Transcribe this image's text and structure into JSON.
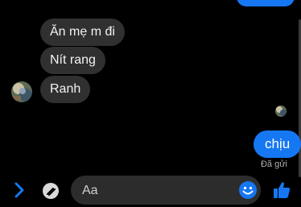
{
  "thread": {
    "incoming": [
      {
        "text": "Ăn mẹ m đi"
      },
      {
        "text": "Nít rang"
      },
      {
        "text": "Ranh"
      }
    ],
    "outgoing": [
      {
        "text": "chịu"
      }
    ],
    "sent_status": "Đã gửi"
  },
  "composer": {
    "placeholder": "Aa"
  },
  "icons": {
    "expand": "chevron-right-icon",
    "attach": "attachment-icon",
    "emoji": "emoji-icon",
    "like": "thumbs-up-icon"
  },
  "colors": {
    "accent": "#1677f2",
    "incoming_bubble": "#303030",
    "background": "#000000"
  }
}
